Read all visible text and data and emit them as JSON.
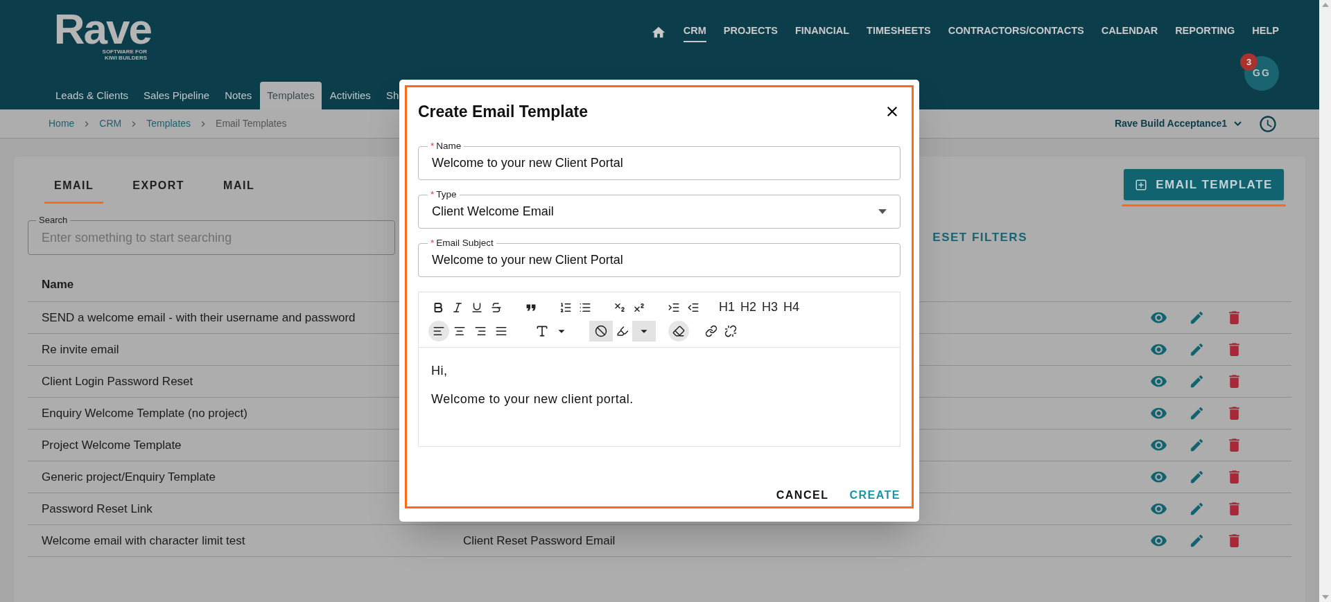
{
  "logo": {
    "name": "Rave",
    "tagline": [
      "SOFTWARE FOR",
      "KIWI BUILDERS"
    ]
  },
  "main_nav": [
    {
      "label": "CRM",
      "selected": true
    },
    {
      "label": "PROJECTS",
      "selected": false
    },
    {
      "label": "FINANCIAL",
      "selected": false
    },
    {
      "label": "TIMESHEETS",
      "selected": false
    },
    {
      "label": "CONTRACTORS/CONTACTS",
      "selected": false
    },
    {
      "label": "CALENDAR",
      "selected": false
    },
    {
      "label": "REPORTING",
      "selected": false
    },
    {
      "label": "HELP",
      "selected": false
    }
  ],
  "user": {
    "initials": "GG",
    "badge": "3"
  },
  "sub_nav": [
    {
      "label": "Leads & Clients",
      "selected": false
    },
    {
      "label": "Sales Pipeline",
      "selected": false
    },
    {
      "label": "Notes",
      "selected": false
    },
    {
      "label": "Templates",
      "selected": true
    },
    {
      "label": "Activities",
      "selected": false
    },
    {
      "label": "Sh",
      "selected": false
    }
  ],
  "breadcrumb": [
    "Home",
    "CRM",
    "Templates",
    "Email Templates"
  ],
  "company_selector": "Rave Build Acceptance1",
  "tabs": [
    {
      "label": "EMAIL",
      "selected": true
    },
    {
      "label": "EXPORT",
      "selected": false
    },
    {
      "label": "MAIL",
      "selected": false
    }
  ],
  "add_button": "EMAIL TEMPLATE",
  "search": {
    "label": "Search",
    "placeholder": "Enter something to start searching"
  },
  "reset_filters": "ESET FILTERS",
  "table": {
    "columns": [
      "Name"
    ],
    "rows": [
      {
        "name": "SEND a welcome email - with their username and password"
      },
      {
        "name": "Re invite email"
      },
      {
        "name": "Client Login Password Reset"
      },
      {
        "name": "Enquiry Welcome Template (no project)"
      },
      {
        "name": "Project Welcome Template"
      },
      {
        "name": "Generic project/Enquiry Template"
      },
      {
        "name": "Password Reset Link"
      },
      {
        "name": "Welcome email with character limit test",
        "type": "Client Reset Password Email"
      }
    ]
  },
  "dialog": {
    "title": "Create Email Template",
    "fields": [
      {
        "required_mark": "*",
        "label": "Name",
        "kind": "text",
        "value": "Welcome to your new Client Portal"
      },
      {
        "required_mark": "*",
        "label": "Type",
        "kind": "select",
        "value": "Client Welcome Email"
      },
      {
        "required_mark": "*",
        "label": "Email Subject",
        "kind": "text",
        "value": "Welcome to your new Client Portal"
      }
    ],
    "headings": [
      "H1",
      "H2",
      "H3",
      "H4"
    ],
    "alignments": [
      {
        "kind": "left",
        "selected": true
      },
      {
        "kind": "center",
        "selected": false
      },
      {
        "kind": "right",
        "selected": false
      },
      {
        "kind": "justify",
        "selected": false
      }
    ],
    "body": [
      "Hi,",
      "Welcome to your new client portal."
    ],
    "buttons": [
      {
        "label": "CANCEL",
        "kind": "secondary"
      },
      {
        "label": "CREATE",
        "kind": "primary"
      }
    ]
  }
}
